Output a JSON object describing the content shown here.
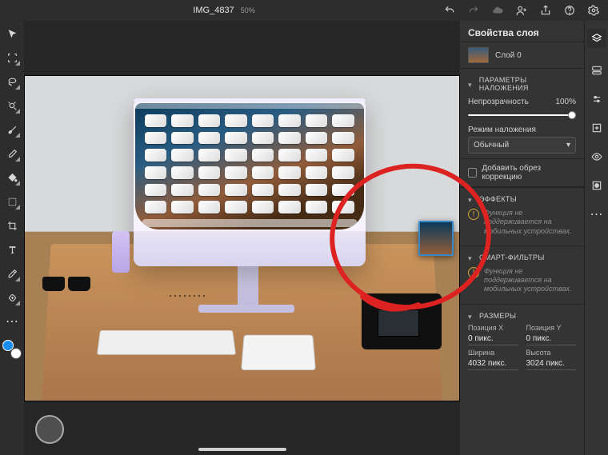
{
  "document": {
    "title": "IMG_4837",
    "zoom": "50%"
  },
  "toolbar_top": {
    "undo": "undo-icon",
    "redo": "redo-icon",
    "cloud": "cloud-icon",
    "invite": "invite-icon",
    "share": "share-icon",
    "help": "help-icon",
    "settings": "settings-icon"
  },
  "tools": [
    "move-tool",
    "transform-tool",
    "lasso-tool",
    "quick-select-tool",
    "brush-tool",
    "eraser-tool",
    "fill-tool",
    "clone-tool",
    "crop-tool",
    "type-tool",
    "eyedropper-tool",
    "spot-heal-tool",
    "color-swatch"
  ],
  "properties": {
    "panel_title": "Свойства слоя",
    "layer_name": "Слой 0",
    "sections": {
      "blend": {
        "header": "ПАРАМЕТРЫ НАЛОЖЕНИЯ",
        "opacity_label": "Непрозрачность",
        "opacity_value": "100%",
        "mode_label": "Режим наложения",
        "mode_value": "Обычный"
      },
      "clip": {
        "checkbox_label": "Добавить обрез коррекцию"
      },
      "effects": {
        "header": "ЭФФЕКТЫ",
        "warning": "Функция не поддерживается на мобильных устройствах."
      },
      "smart": {
        "header": "СМАРТ-ФИЛЬТРЫ",
        "warning": "Функция не поддерживается на мобильных устройствах."
      },
      "dimensions": {
        "header": "РАЗМЕРЫ",
        "pos_x_label": "Позиция X",
        "pos_x_value": "0 пикс.",
        "pos_y_label": "Позиция Y",
        "pos_y_value": "0 пикс.",
        "width_label": "Ширина",
        "width_value": "4032 пикс.",
        "height_label": "Высота",
        "height_value": "3024 пикс."
      }
    }
  },
  "right_strip": [
    "layers-icon",
    "comments-icon",
    "adjustments-icon",
    "add-layer-icon",
    "visibility-icon",
    "mask-icon",
    "more-icon"
  ]
}
